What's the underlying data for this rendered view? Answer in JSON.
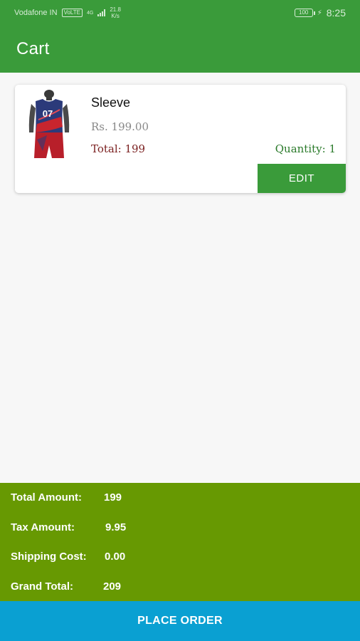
{
  "status_bar": {
    "carrier": "Vodafone IN",
    "volte_tag": "VoLTE",
    "network_type": "4G",
    "net_speed_value": "21.8",
    "net_speed_unit": "K/s",
    "battery": "100",
    "time": "8:25"
  },
  "app_bar": {
    "title": "Cart"
  },
  "cart_item": {
    "name": "Sleeve",
    "price": "Rs. 199.00",
    "total": "Total: 199",
    "quantity": "Quantity: 1",
    "edit_label": "EDIT",
    "jersey_number": "07"
  },
  "summary": {
    "total_amount_label": "Total Amount:",
    "total_amount_value": "199",
    "tax_amount_label": "Tax Amount:",
    "tax_amount_value": "9.95",
    "shipping_cost_label": "Shipping Cost:",
    "shipping_cost_value": "0.00",
    "grand_total_label": "Grand Total:",
    "grand_total_value": "209"
  },
  "place_order_label": "PLACE ORDER",
  "colors": {
    "primary_green": "#3a9b3a",
    "summary_green": "#679902",
    "place_order_blue": "#0aa0d2",
    "total_red": "#7a1f1f",
    "quantity_green": "#2a7a2a"
  }
}
